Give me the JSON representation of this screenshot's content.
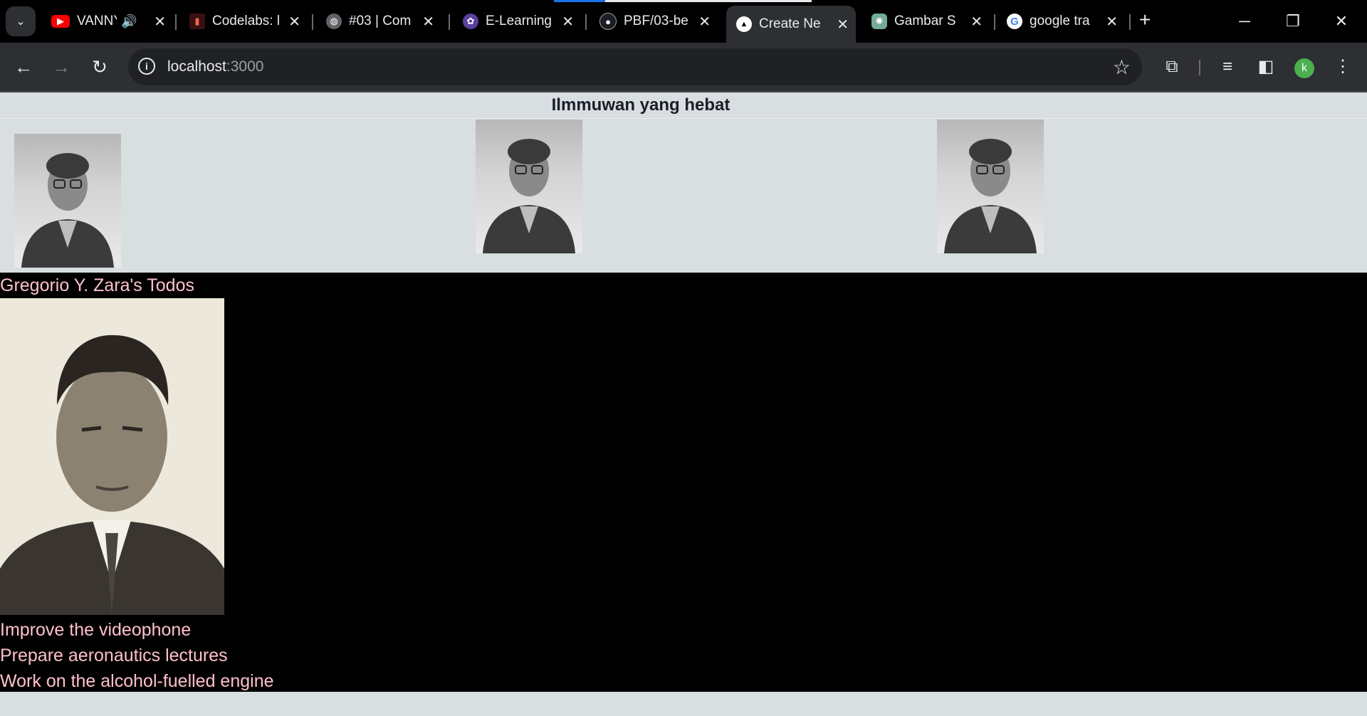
{
  "browser": {
    "tabs": [
      {
        "title": "VANNY",
        "icon": "youtube-icon",
        "audio": true
      },
      {
        "title": "Codelabs: l",
        "icon": "codelabs-icon"
      },
      {
        "title": "#03 | Com",
        "icon": "globe-icon"
      },
      {
        "title": "E-Learning",
        "icon": "university-icon"
      },
      {
        "title": "PBF/03-be",
        "icon": "github-icon"
      },
      {
        "title": "Create Ne",
        "icon": "nextjs-icon",
        "active": true
      },
      {
        "title": "Gambar S",
        "icon": "chatgpt-icon"
      },
      {
        "title": "google tra",
        "icon": "google-icon"
      }
    ],
    "url_host": "localhost",
    "url_port": ":3000",
    "profile_initial": "k"
  },
  "page": {
    "gallery_heading": "Ilmmuwan yang hebat",
    "todo_title": "Gregorio Y. Zara's Todos",
    "todos": [
      "Improve the videophone",
      "Prepare aeronautics lectures",
      "Work on the alcohol-fuelled engine"
    ]
  }
}
